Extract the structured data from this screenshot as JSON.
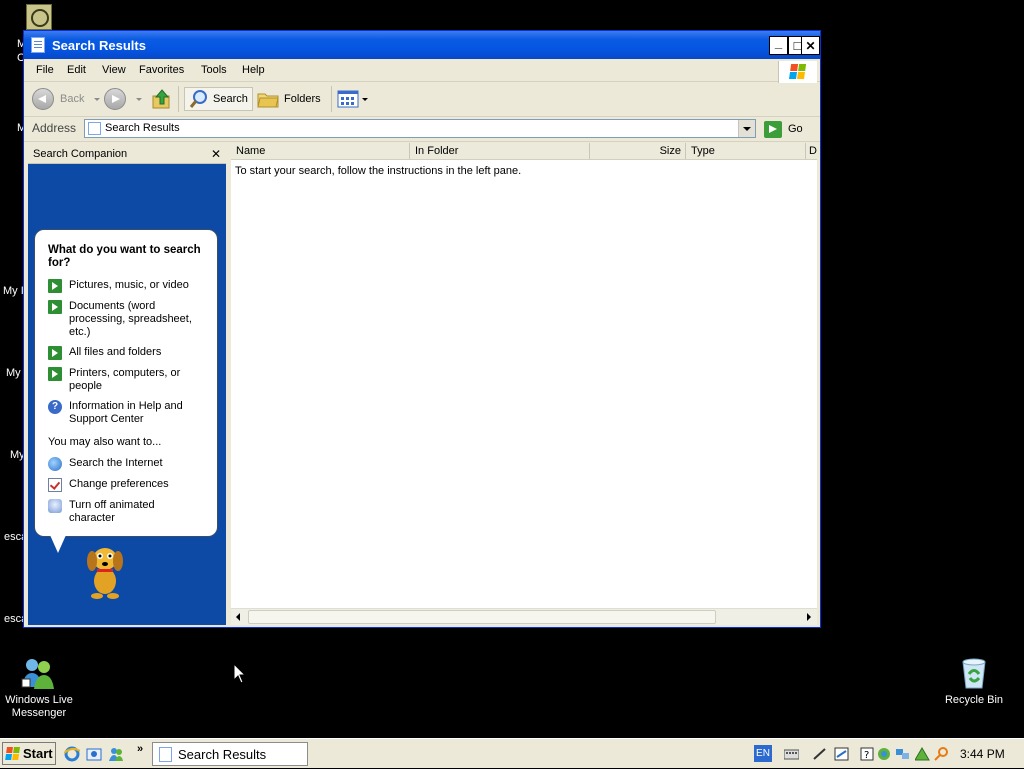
{
  "window": {
    "title": "Search Results",
    "controls": {
      "minimize": "_",
      "maximize": "□",
      "close": "✕"
    }
  },
  "menu": [
    "File",
    "Edit",
    "View",
    "Favorites",
    "Tools",
    "Help"
  ],
  "toolbar": {
    "back": "Back",
    "search": "Search",
    "folders": "Folders"
  },
  "address": {
    "label": "Address",
    "value": "Search Results",
    "go": "Go"
  },
  "search_companion": {
    "title": "Search Companion",
    "close": "✕",
    "question": "What do you want to search for?",
    "options": [
      {
        "label": "Pictures, music, or video",
        "icon": "arrow-icon"
      },
      {
        "label": "Documents (word processing, spreadsheet, etc.)",
        "icon": "arrow-icon"
      },
      {
        "label": "All files and folders",
        "icon": "arrow-icon"
      },
      {
        "label": "Printers, computers, or people",
        "icon": "arrow-icon"
      },
      {
        "label": "Information in Help and Support Center",
        "icon": "help-icon"
      }
    ],
    "also": "You may also want to...",
    "more_options": [
      {
        "label": "Search the Internet",
        "icon": "globe-search-icon"
      },
      {
        "label": "Change preferences",
        "icon": "checklist-icon"
      },
      {
        "label": "Turn off animated character",
        "icon": "character-icon"
      }
    ]
  },
  "results": {
    "columns": [
      "Name",
      "In Folder",
      "Size",
      "Type",
      "D"
    ],
    "message": "To start your search, follow the instructions in the left pane."
  },
  "desktop": {
    "icons": [
      {
        "label": "Windows Live Messenger"
      },
      {
        "label": "Recycle Bin"
      }
    ],
    "partial_labels": [
      "M",
      "C",
      "M",
      "My I",
      "My",
      "My",
      "esca",
      "esca"
    ]
  },
  "taskbar": {
    "start": "Start",
    "more": "»",
    "task": "Search Results",
    "language": "EN",
    "clock": "3:44 PM"
  },
  "colors": {
    "titlebar": "#0554e0",
    "companion_bg": "#0c4aa6",
    "window_bg": "#ece9d8",
    "go_green": "#3c9e3a"
  }
}
